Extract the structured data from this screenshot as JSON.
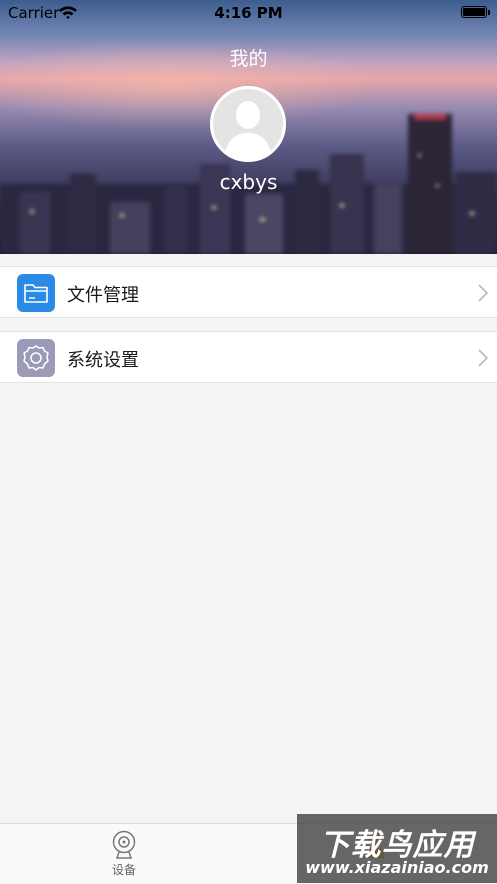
{
  "status_bar": {
    "carrier": "Carrier",
    "time": "4:16 PM"
  },
  "header": {
    "title": "我的",
    "username": "cxbys"
  },
  "menu": [
    {
      "label": "文件管理",
      "icon": "folder-icon",
      "color": "#2b8ae8"
    },
    {
      "label": "系统设置",
      "icon": "gear-icon",
      "color": "#9b9ab8"
    }
  ],
  "tabbar": {
    "device_label": "设备",
    "device_icon": "camera-icon",
    "mine_icon": "person-icon"
  },
  "watermark": {
    "line1": "下载鸟应用",
    "line2": "www.xiazainiao.com"
  }
}
